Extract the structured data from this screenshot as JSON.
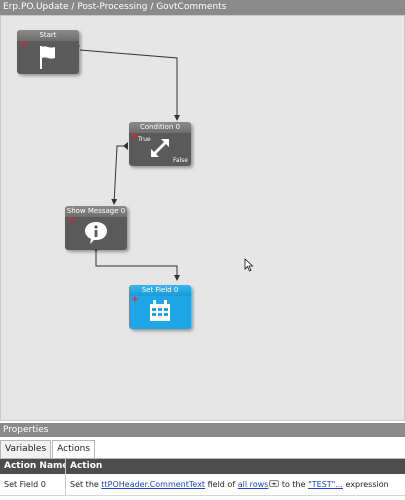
{
  "title_path": "Erp.PO.Update / Post-Processing / GovtComments",
  "canvas": {
    "nodes": {
      "start": {
        "label": "Start",
        "icon": "flag-icon"
      },
      "condition": {
        "label": "Condition 0",
        "icon": "split-arrows-icon",
        "true_label": "True",
        "false_label": "False"
      },
      "show_message": {
        "label": "Show Message 0",
        "icon": "info-bubble-icon"
      },
      "set_field": {
        "label": "Set Field 0",
        "icon": "grid-icon"
      }
    }
  },
  "properties": {
    "title": "Properties",
    "tabs": [
      {
        "label": "Variables"
      },
      {
        "label": "Actions"
      }
    ],
    "active_tab": "Actions",
    "grid": {
      "headers": {
        "action_name": "Action Name",
        "action": "Action"
      },
      "rows": [
        {
          "action_name": "Set Field 0",
          "parts": {
            "p1": "Set the ",
            "field_link": "ttPOHeader.CommentText",
            "p2": " field of ",
            "rows_link": "all rows",
            "p3": " to the ",
            "value_link": "\"TEST\"...",
            "p4": " expression"
          }
        }
      ]
    }
  },
  "colors": {
    "node_gray": "#5a5a5a",
    "node_blue": "#1fa6e6",
    "link": "#1a45c8",
    "add_red": "#e0262f"
  }
}
